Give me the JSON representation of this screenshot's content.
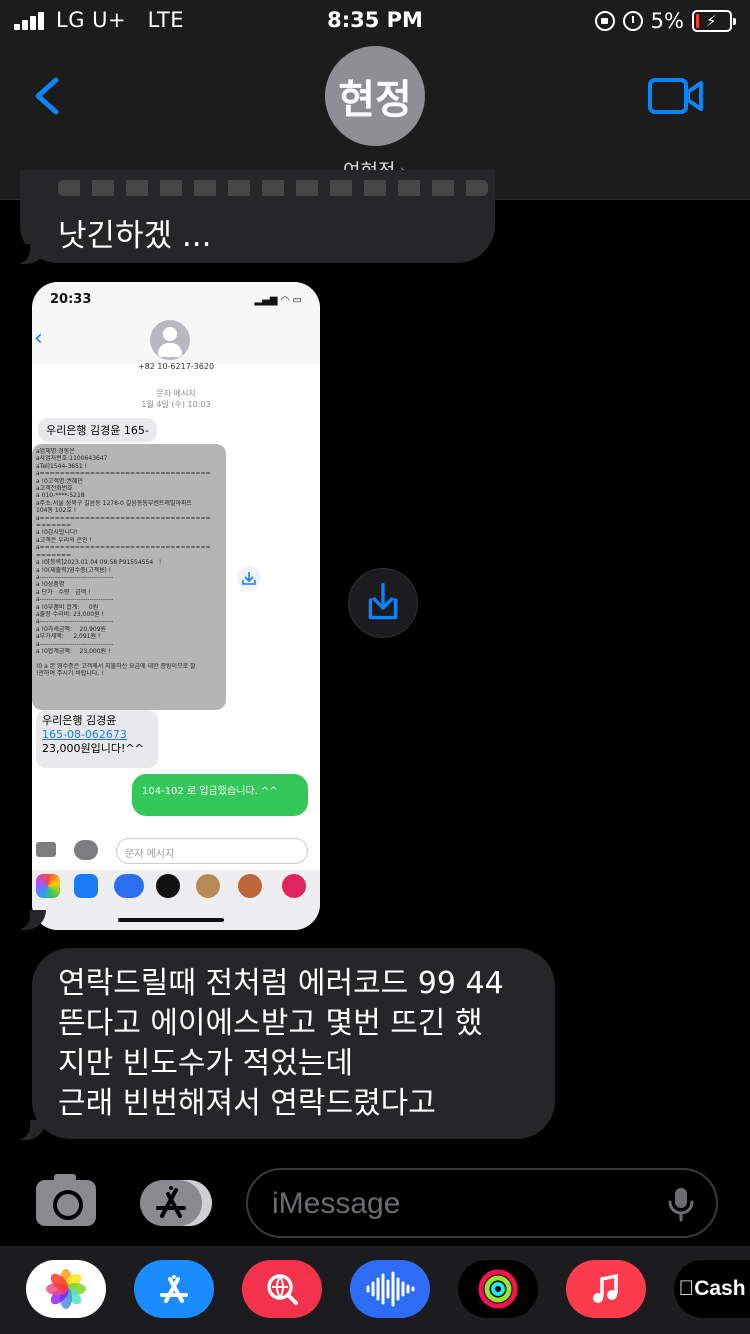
{
  "status_bar": {
    "carrier": "LG U+",
    "network": "LTE",
    "time": "8:35 PM",
    "battery": "5%"
  },
  "header": {
    "avatar_initials": "현정",
    "contact_name": "여현정",
    "chevron": "›"
  },
  "messages": {
    "top_partial": "낫긴하겠 ...",
    "final": "연락드릴때 전처럼 에러코드 99 44\n뜬다고 에이에스받고 몇번 뜨긴 했\n지만 빈도수가 적었는데\n근래 빈번해져서 연락드렸다고"
  },
  "screenshot": {
    "time": "20:33",
    "phone": "+82 10-6217-3620",
    "meta": "문자 메시지\n1월 4일 (수) 10:03",
    "bubble1": "우리은행 김경윤 165-",
    "receipt_lines": [
      "a업체명:경동온",
      "a사업자번호:1100643647",
      "aTel)1544-3651 !",
      "a==================================",
      "a !0고객명:권혜민",
      "a고객전화번호",
      "a 010-****-5218",
      "a주소:서울 성북구 길음동 1278-0 길음동동부센트레빌아파트",
      "104동 102호 !",
      "a==================================",
      "=======",
      "a !0감사합니다!",
      "a고객은 우리의 은인 !",
      "a==================================",
      "=======",
      "a !0[등록]2023.01.04 09:58 P91554554   !",
      "a !0(재출력)영수증(고객용) !",
      "a----------------------------------",
      "a !0상품명",
      "a 단가   수량   금액 !",
      "a----------------------------------",
      "a !0부품비 합계:     0원",
      "a출장 수리비: 23,000원 !",
      "a----------------------------------",
      "a !0과세금액:    20,909원",
      "a부가세액:     2,091원 !",
      "a----------------------------------",
      "a !0합계금액:    23,000원 !",
      "",
      "!0 a 본 영수증은 고객께서 지불하신 요금에 대한 증빙이므로 잘",
      "!관하여 주시기 바랍니다. !"
    ],
    "bubble3_line1": "우리은행 김경윤",
    "bubble3_account": "165-08-062673",
    "bubble3_line3": "23,000원입니다!^^",
    "green_message": "104-102 로 입금했습니다. ^^",
    "input_placeholder": "문자 메시지"
  },
  "input": {
    "placeholder": "iMessage"
  },
  "drawer": {
    "cash_label": "Cash",
    "apps": [
      "photos",
      "app-store",
      "web-search",
      "audio-messages",
      "activity",
      "music",
      "apple-cash"
    ]
  }
}
